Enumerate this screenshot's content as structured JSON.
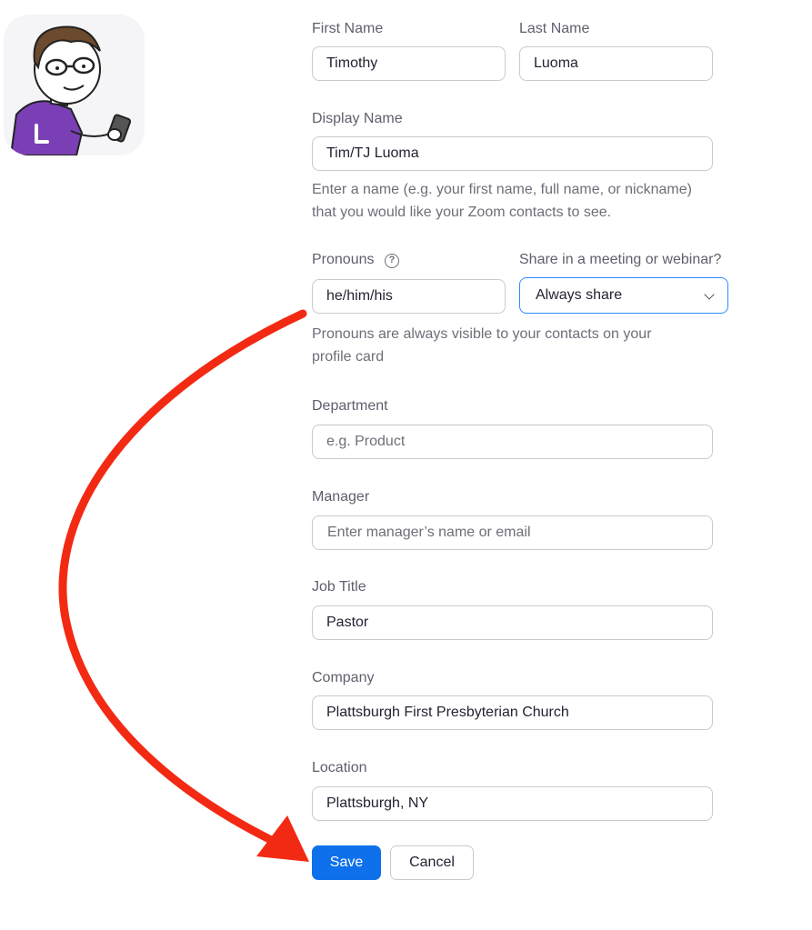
{
  "form": {
    "first_name": {
      "label": "First Name",
      "value": "Timothy"
    },
    "last_name": {
      "label": "Last Name",
      "value": "Luoma"
    },
    "display_name": {
      "label": "Display Name",
      "value": "Tim/TJ Luoma",
      "help_line1": "Enter a name (e.g. your first name, full name, or nickname)",
      "help_line2": "that you would like your Zoom contacts to see."
    },
    "pronouns": {
      "label": "Pronouns",
      "value": "he/him/his",
      "help_line1": "Pronouns are always visible to your contacts on your",
      "help_line2": "profile card"
    },
    "share": {
      "label": "Share in a meeting or webinar?",
      "selected": "Always share"
    },
    "department": {
      "label": "Department",
      "placeholder": "e.g. Product"
    },
    "manager": {
      "label": "Manager",
      "placeholder": "Enter manager’s name or email"
    },
    "job_title": {
      "label": "Job Title",
      "value": "Pastor"
    },
    "company": {
      "label": "Company",
      "value": "Plattsburgh First Presbyterian Church"
    },
    "location": {
      "label": "Location",
      "value": "Plattsburgh, NY"
    }
  },
  "buttons": {
    "save": "Save",
    "cancel": "Cancel"
  },
  "icons": {
    "help": "question-circle-icon",
    "dropdown": "chevron-down-icon"
  },
  "colors": {
    "primary": "#0e71eb",
    "focus_border": "#2d8cff",
    "annotation_arrow": "#f32a13",
    "avatar_shirt": "#7b3fb5"
  }
}
